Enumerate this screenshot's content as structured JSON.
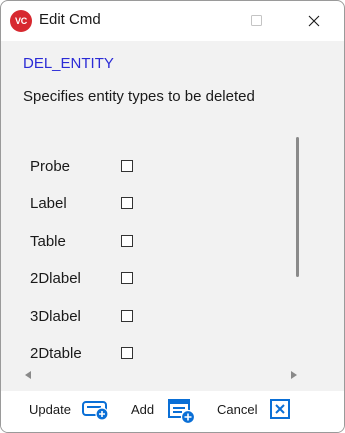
{
  "window": {
    "app_icon_text": "VC",
    "title": "Edit Cmd"
  },
  "command": {
    "name": "DEL_ENTITY",
    "description": "Specifies entity types to be deleted"
  },
  "options": [
    {
      "label": "Probe",
      "checked": false
    },
    {
      "label": "Label",
      "checked": false
    },
    {
      "label": "Table",
      "checked": false
    },
    {
      "label": "2Dlabel",
      "checked": false
    },
    {
      "label": "3Dlabel",
      "checked": false
    },
    {
      "label": "2Dtable",
      "checked": false
    }
  ],
  "buttons": {
    "update": "Update",
    "add": "Add",
    "cancel": "Cancel"
  },
  "colors": {
    "accent": "#0a6fd6",
    "command_name": "#2b2bd6",
    "app_icon": "#d7282f"
  }
}
